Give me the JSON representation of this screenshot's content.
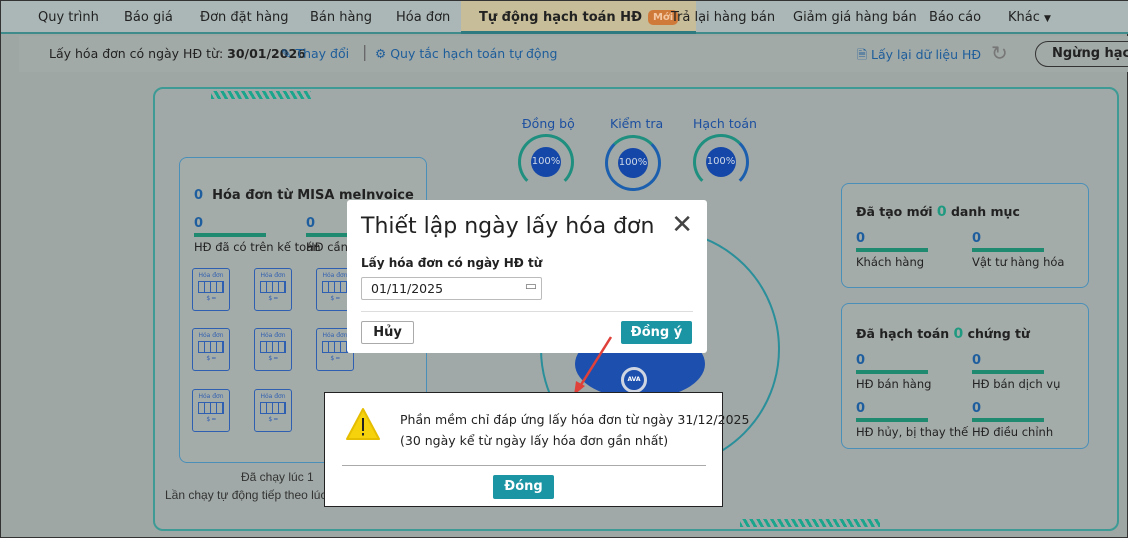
{
  "nav": {
    "tabs": [
      "Quy trình",
      "Báo giá",
      "Đơn đặt hàng",
      "Bán hàng",
      "Hóa đơn",
      "Tự động hạch toán HĐ",
      "Trả lại hàng bán",
      "Giảm giá hàng bán",
      "Báo cáo",
      "Khác"
    ],
    "new_badge": "Mới",
    "more_arrow": "▼"
  },
  "toolbar": {
    "date_label": "Lấy hóa đơn có ngày HĐ từ:",
    "date_value": "30/01/2026",
    "change": "Thay đổi",
    "rules": "Quy tắc hạch toán tự động",
    "reload": "Lấy lại dữ liệu HĐ",
    "stop": "Ngừng hạch toán"
  },
  "progress": [
    {
      "label": "Đồng bộ",
      "value": "100%"
    },
    {
      "label": "Kiểm tra",
      "value": "100%"
    },
    {
      "label": "Hạch toán",
      "value": "100%"
    }
  ],
  "invoices": {
    "count": "0",
    "title": "Hóa đơn từ MISA meInvoice",
    "stats": [
      {
        "value": "0",
        "label": "HĐ đã có trên kế toán"
      },
      {
        "value": "0",
        "label": "HĐ cần h"
      }
    ],
    "doc_label": "Hóa đơn",
    "last_run": "Đã chạy lúc 1",
    "next_run": "Lần chạy tự động tiếp theo lúc"
  },
  "categories": {
    "prefix": "Đã tạo mới",
    "count": "0",
    "suffix": "danh mục",
    "stats": [
      {
        "value": "0",
        "label": "Khách hàng"
      },
      {
        "value": "0",
        "label": "Vật tư hàng hóa"
      }
    ]
  },
  "vouchers": {
    "prefix": "Đã hạch toán",
    "count": "0",
    "suffix": "chứng từ",
    "stats": [
      {
        "value": "0",
        "label": "HĐ bán hàng"
      },
      {
        "value": "0",
        "label": "HĐ bán dịch vụ"
      },
      {
        "value": "0",
        "label": "HĐ hủy, bị thay thế"
      },
      {
        "value": "0",
        "label": "HĐ điều chỉnh"
      }
    ]
  },
  "center_logo": "AVA",
  "modal": {
    "title": "Thiết lập ngày lấy hóa đơn",
    "field_label": "Lấy hóa đơn có ngày HĐ từ",
    "date_value": "01/11/2025",
    "cancel": "Hủy",
    "ok": "Đồng ý"
  },
  "alert": {
    "line1": "Phần mềm chỉ đáp ứng lấy hóa đơn từ ngày 31/12/2025",
    "line2": "(30 ngày kể từ ngày lấy hóa đơn gần nhất)",
    "close": "Đóng"
  }
}
